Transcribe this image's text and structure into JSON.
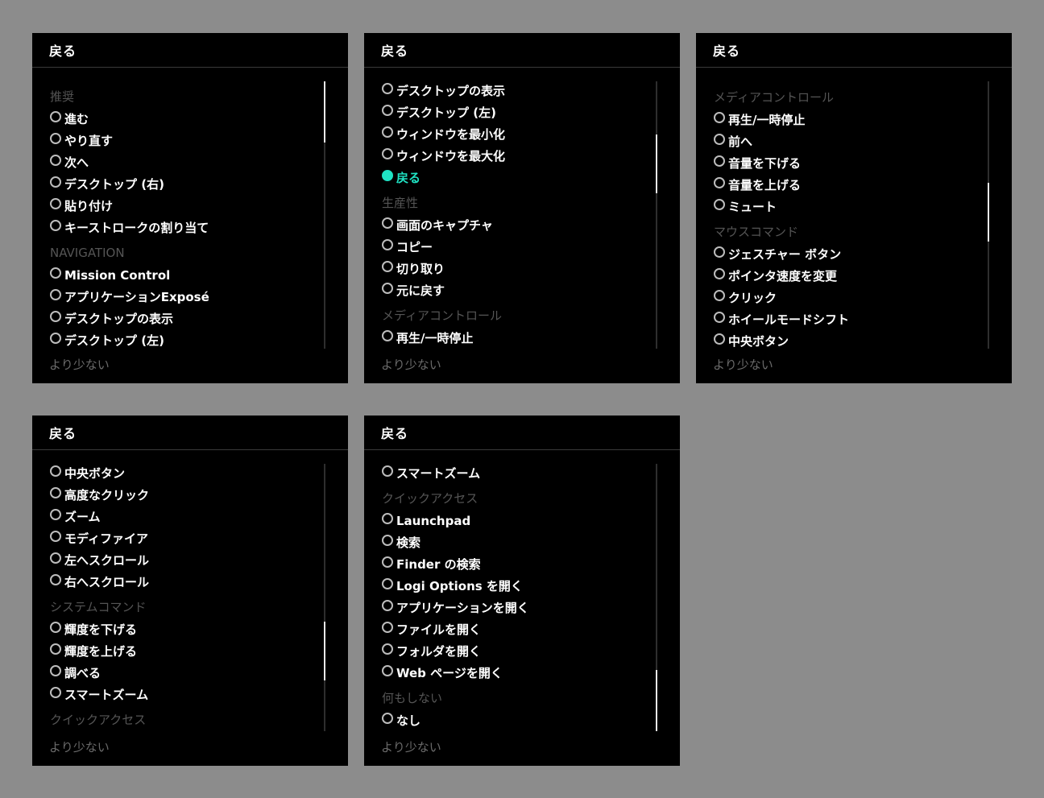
{
  "panels": [
    {
      "back_label": "戻る",
      "less_label": "より少ない",
      "scroll": {
        "thumb_start": 0.0,
        "thumb_size": 0.23
      },
      "rows": [
        {
          "kind": "section",
          "text": "推奨"
        },
        {
          "kind": "item",
          "text": "進む"
        },
        {
          "kind": "item",
          "text": "やり直す"
        },
        {
          "kind": "item",
          "text": "次へ"
        },
        {
          "kind": "item",
          "text": "デスクトップ (右)"
        },
        {
          "kind": "item",
          "text": "貼り付け"
        },
        {
          "kind": "item",
          "text": "キーストロークの割り当て"
        },
        {
          "kind": "section",
          "text": "NAVIGATION"
        },
        {
          "kind": "item",
          "text": "Mission Control"
        },
        {
          "kind": "item",
          "text": "アプリケーションExposé"
        },
        {
          "kind": "item",
          "text": "デスクトップの表示"
        },
        {
          "kind": "item",
          "text": "デスクトップ (左)"
        }
      ]
    },
    {
      "back_label": "戻る",
      "less_label": "より少ない",
      "scroll": {
        "thumb_start": 0.2,
        "thumb_size": 0.22
      },
      "rows": [
        {
          "kind": "item",
          "text": "デスクトップの表示"
        },
        {
          "kind": "item",
          "text": "デスクトップ (左)"
        },
        {
          "kind": "item",
          "text": "ウィンドウを最小化"
        },
        {
          "kind": "item",
          "text": "ウィンドウを最大化"
        },
        {
          "kind": "item",
          "text": "戻る",
          "selected": true
        },
        {
          "kind": "section",
          "text": "生産性"
        },
        {
          "kind": "item",
          "text": "画面のキャプチャ"
        },
        {
          "kind": "item",
          "text": "コピー"
        },
        {
          "kind": "item",
          "text": "切り取り"
        },
        {
          "kind": "item",
          "text": "元に戻す"
        },
        {
          "kind": "section",
          "text": "メディアコントロール"
        },
        {
          "kind": "item",
          "text": "再生/一時停止"
        }
      ]
    },
    {
      "back_label": "戻る",
      "less_label": "より少ない",
      "scroll": {
        "thumb_start": 0.38,
        "thumb_size": 0.22
      },
      "rows": [
        {
          "kind": "section",
          "text": "メディアコントロール"
        },
        {
          "kind": "item",
          "text": "再生/一時停止"
        },
        {
          "kind": "item",
          "text": "前へ"
        },
        {
          "kind": "item",
          "text": "音量を下げる"
        },
        {
          "kind": "item",
          "text": "音量を上げる"
        },
        {
          "kind": "item",
          "text": "ミュート"
        },
        {
          "kind": "section",
          "text": "マウスコマンド"
        },
        {
          "kind": "item",
          "text": "ジェスチャー ボタン"
        },
        {
          "kind": "item",
          "text": "ポインタ速度を変更"
        },
        {
          "kind": "item",
          "text": "クリック"
        },
        {
          "kind": "item",
          "text": "ホイールモードシフト"
        },
        {
          "kind": "item",
          "text": "中央ボタン"
        }
      ]
    },
    {
      "back_label": "戻る",
      "less_label": "より少ない",
      "scroll": {
        "thumb_start": 0.59,
        "thumb_size": 0.22
      },
      "rows": [
        {
          "kind": "item",
          "text": "中央ボタン"
        },
        {
          "kind": "item",
          "text": "高度なクリック"
        },
        {
          "kind": "item",
          "text": "ズーム"
        },
        {
          "kind": "item",
          "text": "モディファイア"
        },
        {
          "kind": "item",
          "text": "左へスクロール"
        },
        {
          "kind": "item",
          "text": "右へスクロール"
        },
        {
          "kind": "section",
          "text": "システムコマンド"
        },
        {
          "kind": "item",
          "text": "輝度を下げる"
        },
        {
          "kind": "item",
          "text": "輝度を上げる"
        },
        {
          "kind": "item",
          "text": "調べる"
        },
        {
          "kind": "item",
          "text": "スマートズーム"
        },
        {
          "kind": "section",
          "text": "クイックアクセス"
        }
      ]
    },
    {
      "back_label": "戻る",
      "less_label": "より少ない",
      "scroll": {
        "thumb_start": 0.77,
        "thumb_size": 0.23
      },
      "rows": [
        {
          "kind": "item",
          "text": "スマートズーム"
        },
        {
          "kind": "section",
          "text": "クイックアクセス"
        },
        {
          "kind": "item",
          "text": "Launchpad"
        },
        {
          "kind": "item",
          "text": "検索"
        },
        {
          "kind": "item",
          "text": "Finder の検索"
        },
        {
          "kind": "item",
          "text": "Logi Options を開く"
        },
        {
          "kind": "item",
          "text": "アプリケーションを開く"
        },
        {
          "kind": "item",
          "text": "ファイルを開く"
        },
        {
          "kind": "item",
          "text": "フォルダを開く"
        },
        {
          "kind": "item",
          "text": "Web ページを開く"
        },
        {
          "kind": "section",
          "text": "何もしない"
        },
        {
          "kind": "item",
          "text": "なし"
        }
      ]
    }
  ]
}
